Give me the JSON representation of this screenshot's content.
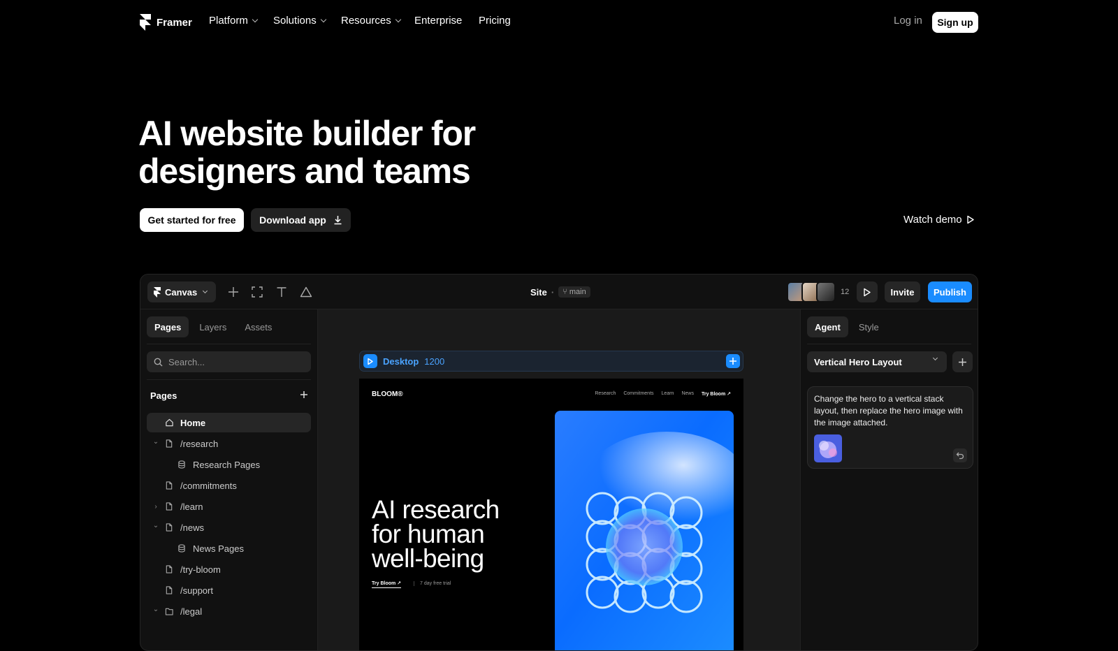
{
  "nav": {
    "brand": "Framer",
    "items": [
      {
        "label": "Platform"
      },
      {
        "label": "Solutions"
      },
      {
        "label": "Resources"
      },
      {
        "label": "Enterprise"
      },
      {
        "label": "Pricing"
      }
    ],
    "login": "Log in",
    "signup": "Sign up"
  },
  "hero": {
    "title_line1": "AI website builder for",
    "title_line2": "designers and teams",
    "primary_cta": "Get started for free",
    "secondary_cta": "Download app",
    "watch_demo": "Watch demo"
  },
  "app": {
    "canvas_label": "Canvas",
    "site_label": "Site",
    "branch": "main",
    "collaborator_count": "12",
    "invite": "Invite",
    "publish": "Publish",
    "accent": "#1a8cff",
    "left_tabs": [
      "Pages",
      "Layers",
      "Assets"
    ],
    "search_placeholder": "Search...",
    "pages_heading": "Pages",
    "pages": [
      {
        "label": "Home",
        "icon": "home-icon",
        "caret": "",
        "indent": 0,
        "active": true
      },
      {
        "label": "/research",
        "icon": "page-icon",
        "caret": "down",
        "indent": 0
      },
      {
        "label": "Research Pages",
        "icon": "database-icon",
        "caret": "",
        "indent": 1
      },
      {
        "label": "/commitments",
        "icon": "page-icon",
        "caret": "",
        "indent": 0
      },
      {
        "label": "/learn",
        "icon": "page-icon",
        "caret": "right",
        "indent": 0
      },
      {
        "label": "/news",
        "icon": "page-icon",
        "caret": "down",
        "indent": 0
      },
      {
        "label": "News Pages",
        "icon": "database-icon",
        "caret": "",
        "indent": 1
      },
      {
        "label": "/try-bloom",
        "icon": "page-icon",
        "caret": "",
        "indent": 0
      },
      {
        "label": "/support",
        "icon": "page-icon",
        "caret": "",
        "indent": 0
      },
      {
        "label": "/legal",
        "icon": "folder-icon",
        "caret": "down",
        "indent": 0
      }
    ],
    "frame": {
      "name": "Desktop",
      "width": "1200"
    },
    "preview": {
      "logo": "BLOOM®",
      "links": [
        "Research",
        "Commitments",
        "Learn",
        "News"
      ],
      "cta": "Try Bloom ↗",
      "title_line1": "AI research",
      "title_line2": "for human",
      "title_line3": "well-being",
      "try_link": "Try Bloom ↗",
      "trial": "7 day free trial"
    },
    "right_tabs": [
      "Agent",
      "Style"
    ],
    "layout_select": "Vertical Hero Layout",
    "agent_message": "Change the hero to a vertical stack layout, then replace the hero image with the image attached."
  }
}
